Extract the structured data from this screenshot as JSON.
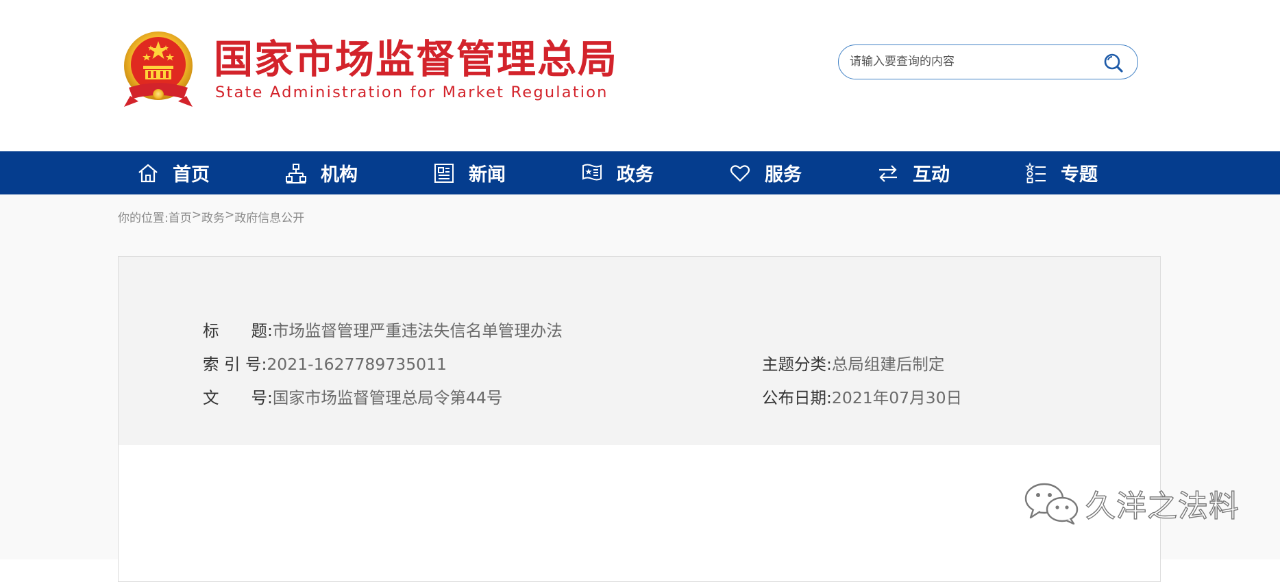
{
  "header": {
    "title_cn": "国家市场监督管理总局",
    "title_en": "State Administration for Market Regulation",
    "emblem_icon": "national-emblem-icon",
    "brand_red": "#d3232b"
  },
  "search": {
    "placeholder": "请输入要查询的内容",
    "icon": "search-icon",
    "border_color": "#3e7fc4"
  },
  "nav": {
    "background": "#053d8e",
    "items": [
      {
        "label": "首页",
        "icon": "home-icon"
      },
      {
        "label": "机构",
        "icon": "org-chart-icon"
      },
      {
        "label": "新闻",
        "icon": "newspaper-icon"
      },
      {
        "label": "政务",
        "icon": "government-badge-icon"
      },
      {
        "label": "服务",
        "icon": "heart-icon"
      },
      {
        "label": "互动",
        "icon": "exchange-arrows-icon"
      },
      {
        "label": "专题",
        "icon": "topic-list-icon"
      }
    ]
  },
  "breadcrumb": {
    "prefix": "你的位置:",
    "items": [
      "首页",
      "政务",
      "政府信息公开"
    ],
    "separator": ">"
  },
  "document_info": {
    "title_label": "标　　题:",
    "title_value": "市场监督管理严重违法失信名单管理办法",
    "index_label": "索 引 号:",
    "index_value": "2021-1627789735011",
    "topic_label": "主题分类:",
    "topic_value": "总局组建后制定",
    "docno_label": "文　　号:",
    "docno_value": "国家市场监督管理总局令第44号",
    "date_label": "公布日期:",
    "date_value": "2021年07月30日"
  },
  "watermark": {
    "text": "久洋之法料",
    "icon": "wechat-icon"
  }
}
